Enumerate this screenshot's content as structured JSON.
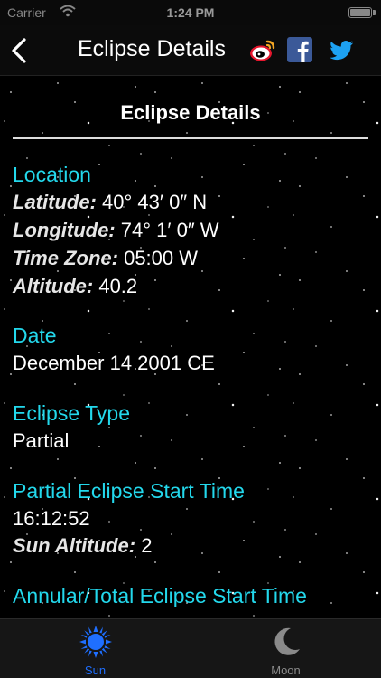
{
  "status_bar": {
    "carrier": "Carrier",
    "time": "1:24 PM"
  },
  "nav": {
    "title": "Eclipse Details",
    "icons": [
      "chevron-left-icon",
      "weibo-icon",
      "facebook-icon",
      "twitter-icon"
    ]
  },
  "content": {
    "section_header": "Eclipse Details",
    "location": {
      "heading": "Location",
      "latitude_label": "Latitude:",
      "latitude_value": "40° 43′ 0″ N",
      "longitude_label": "Longitude:",
      "longitude_value": "74° 1′ 0″ W",
      "timezone_label": "Time Zone:",
      "timezone_value": "05:00 W",
      "altitude_label": "Altitude:",
      "altitude_value": "40.2"
    },
    "date": {
      "heading": "Date",
      "value": "December 14 2001 CE"
    },
    "eclipse_type": {
      "heading": "Eclipse Type",
      "value": "Partial"
    },
    "partial_start": {
      "heading": "Partial Eclipse Start Time",
      "time": "16:12:52",
      "sun_altitude_label": "Sun Altitude:",
      "sun_altitude_value": "2"
    },
    "annular_total_start": {
      "heading": "Annular/Total Eclipse Start Time"
    }
  },
  "tabs": [
    {
      "label": "Sun",
      "icon": "sun-icon",
      "selected": true
    },
    {
      "label": "Moon",
      "icon": "moon-icon",
      "selected": false
    }
  ],
  "colors": {
    "heading": "#23d8ec",
    "tab_active": "#1f6fff",
    "tab_inactive": "#8a8a8a"
  }
}
